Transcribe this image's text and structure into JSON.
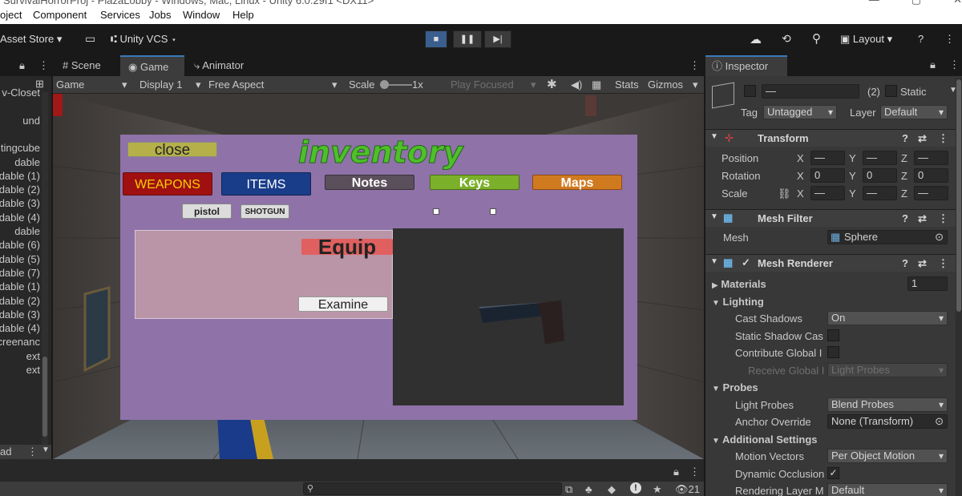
{
  "titlebar": {
    "text": "SurvivalHorrorProj - PlazaLobby - Windows, Mac, Linux - Unity 6.0.29f1 <DX11>"
  },
  "menu": [
    "oject",
    "Component",
    "Services",
    "Jobs",
    "Window",
    "Help"
  ],
  "toolbar": {
    "asset_store": "Asset Store",
    "vcs": "Unity VCS",
    "layout": "Layout"
  },
  "tabs": {
    "scene": "Scene",
    "game": "Game",
    "animator": "Animator",
    "inspector": "Inspector"
  },
  "game_toolbar": {
    "mode": "Game",
    "display": "Display 1",
    "aspect": "Free Aspect",
    "scale_label": "Scale",
    "scale_value": "1x",
    "play_focused": "Play Focused",
    "stats": "Stats",
    "gizmos": "Gizmos"
  },
  "hierarchy": {
    "items": [
      "v-Closet",
      "",
      "und",
      "",
      "ntingcube",
      "dable",
      "dable (1)",
      "dable (2)",
      "dable (3)",
      "dable (4)",
      "dable",
      "dable (6)",
      "dable (5)",
      "dable (7)",
      "dable (1)",
      "dable (2)",
      "dable (3)",
      "dable (4)",
      "creenanc",
      "ext",
      "ext"
    ],
    "bottom": "ad"
  },
  "game": {
    "close": "close",
    "title": "inventory",
    "tabs": [
      "WEAPONS",
      "ITEMS",
      "Notes",
      "Keys",
      "Maps"
    ],
    "weapons": [
      "pistol",
      "SHOTGUN"
    ],
    "equip": "Equip",
    "examine": "Examine"
  },
  "bottom_bar": {
    "count": "21"
  },
  "inspector": {
    "name_field": "—",
    "count": "(2)",
    "static": "Static",
    "tag_label": "Tag",
    "tag_value": "Untagged",
    "layer_label": "Layer",
    "layer_value": "Default",
    "transform": {
      "title": "Transform",
      "position": "Position",
      "rotation": "Rotation",
      "scale": "Scale",
      "x": "X",
      "y": "Y",
      "z": "Z",
      "pos_x": "—",
      "pos_y": "—",
      "pos_z": "—",
      "rot_x": "0",
      "rot_y": "0",
      "rot_z": "0",
      "scl_x": "—",
      "scl_y": "—",
      "scl_z": "—"
    },
    "mesh_filter": {
      "title": "Mesh Filter",
      "mesh_label": "Mesh",
      "mesh_value": "Sphere"
    },
    "mesh_renderer": {
      "title": "Mesh Renderer",
      "materials": "Materials",
      "materials_count": "1",
      "lighting": "Lighting",
      "cast_shadows": "Cast Shadows",
      "cast_shadows_value": "On",
      "static_shadow": "Static Shadow Cas",
      "contribute_gi": "Contribute Global I",
      "receive_gi": "Receive Global I",
      "receive_gi_value": "Light Probes",
      "probes": "Probes",
      "light_probes": "Light Probes",
      "light_probes_value": "Blend Probes",
      "anchor_override": "Anchor Override",
      "anchor_value": "None (Transform)",
      "additional": "Additional Settings",
      "motion_vectors": "Motion Vectors",
      "motion_vectors_value": "Per Object Motion",
      "dynamic_occlusion": "Dynamic Occlusion",
      "rendering_layer": "Rendering Layer M",
      "rendering_layer_value": "Default"
    }
  },
  "colors": {
    "weapons": "#a01010",
    "items": "#1a3d8a",
    "notes": "#5a4f5a",
    "keys": "#7ab02a",
    "maps": "#d07a20",
    "close": "#b5b04a",
    "title": "#4fbf2a",
    "panel": "#8e72a8",
    "equip": "#e06060"
  }
}
